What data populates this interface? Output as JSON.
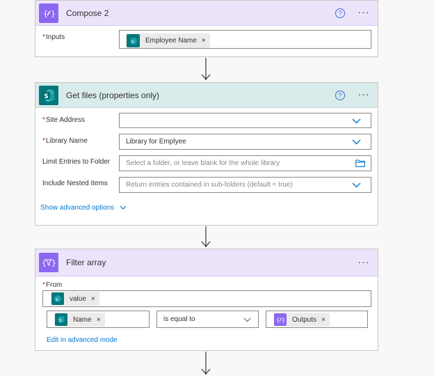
{
  "compose": {
    "title": "Compose 2",
    "help": "?",
    "more": "···",
    "inputs_label": "Inputs",
    "token": {
      "label": "Employee Name",
      "remove": "×",
      "icon": "sharepoint-icon"
    }
  },
  "get_files": {
    "title": "Get files (properties only)",
    "help": "?",
    "more": "···",
    "fields": {
      "site_address": {
        "label": "Site Address",
        "value": ""
      },
      "library_name": {
        "label": "Library Name",
        "value": "Library for Emplyee"
      },
      "limit_folder": {
        "label": "Limit Entries to Folder",
        "placeholder": "Select a folder, or leave blank for the whole library"
      },
      "nested_items": {
        "label": "Include Nested Items",
        "placeholder": "Return entries contained in sub-folders (default = true)"
      }
    },
    "advanced_link": "Show advanced options"
  },
  "filter": {
    "title": "Filter array",
    "more": "···",
    "from_label": "From",
    "from_token": {
      "label": "value",
      "remove": "×"
    },
    "left_token": {
      "label": "Name",
      "remove": "×"
    },
    "operator": "is equal to",
    "right_token": {
      "label": "Outputs",
      "remove": "×"
    },
    "edit_link": "Edit in advanced mode"
  },
  "colors": {
    "purple": "#8c68f0",
    "teal": "#03787c",
    "link": "#0078d4",
    "required": "#a4262c"
  }
}
